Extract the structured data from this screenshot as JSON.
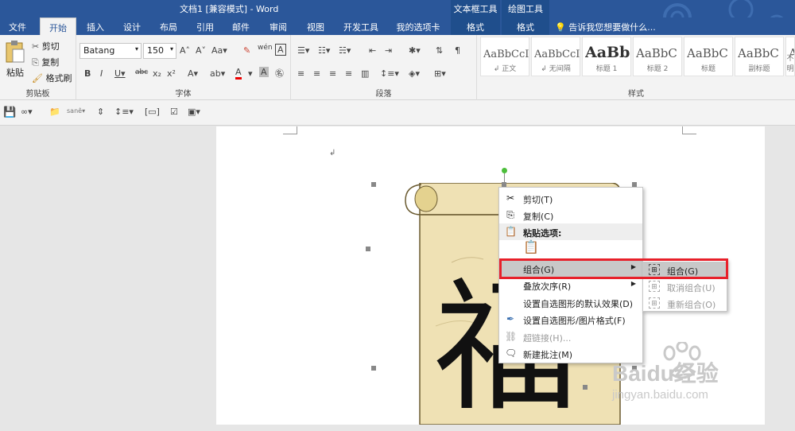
{
  "window": {
    "title": "文档1 [兼容模式] - Word",
    "context_headers": [
      "文本框工具",
      "绘图工具"
    ]
  },
  "tabs": [
    "文件",
    "开始",
    "插入",
    "设计",
    "布局",
    "引用",
    "邮件",
    "审阅",
    "视图",
    "开发工具",
    "我的选项卡",
    "格式",
    "格式"
  ],
  "active_tab_index": 1,
  "tell_me": "告诉我您想要做什么...",
  "clipboard": {
    "group_label": "剪贴板",
    "paste_label": "粘贴",
    "cut_label": "剪切",
    "copy_label": "复制",
    "format_painter_label": "格式刷"
  },
  "font": {
    "group_label": "字体",
    "font_name": "Batang",
    "font_size": "150"
  },
  "paragraph": {
    "group_label": "段落"
  },
  "styles": {
    "group_label": "样式",
    "items": [
      {
        "sample": "AaBbCcI",
        "name": "↲ 正文"
      },
      {
        "sample": "AaBbCcI",
        "name": "↲ 无间隔"
      },
      {
        "sample": "AaBb",
        "name": "标题 1"
      },
      {
        "sample": "AaBbC",
        "name": "标题 2"
      },
      {
        "sample": "AaBbC",
        "name": "标题"
      },
      {
        "sample": "AaBbC",
        "name": "副标题"
      },
      {
        "sample": "Aa",
        "name": "不明"
      }
    ]
  },
  "document": {
    "character": "福",
    "paragraph_mark": "↲"
  },
  "context_menu": {
    "items": [
      {
        "label": "剪切(T)",
        "icon": "scissors-icon",
        "enabled": true
      },
      {
        "label": "复制(C)",
        "icon": "copy-icon",
        "enabled": true
      },
      {
        "label": "粘贴选项:",
        "icon": "paste-icon",
        "enabled": true
      },
      {
        "label": "",
        "icon": "paste-option-icon",
        "enabled": true
      },
      {
        "label": "组合(G)",
        "icon": "",
        "enabled": true,
        "submenu": true
      },
      {
        "label": "叠放次序(R)",
        "icon": "",
        "enabled": true,
        "submenu": true
      },
      {
        "label": "设置自选图形的默认效果(D)",
        "icon": "",
        "enabled": true
      },
      {
        "label": "设置自选图形/图片格式(F)",
        "icon": "format-shape-icon",
        "enabled": true
      },
      {
        "label": "超链接(H)...",
        "icon": "hyperlink-icon",
        "enabled": false
      },
      {
        "label": "新建批注(M)",
        "icon": "comment-icon",
        "enabled": true
      }
    ]
  },
  "submenu": {
    "items": [
      {
        "label": "组合(G)",
        "icon": "group-icon",
        "enabled": true
      },
      {
        "label": "取消组合(U)",
        "icon": "ungroup-icon",
        "enabled": false
      },
      {
        "label": "重新组合(O)",
        "icon": "regroup-icon",
        "enabled": false
      }
    ]
  },
  "watermark": {
    "brand": "Baidu经验",
    "url": "jingyan.baidu.com"
  },
  "colors": {
    "accent": "#2b579a",
    "highlight_box": "#e8202a",
    "scroll": "#efe1b4"
  }
}
